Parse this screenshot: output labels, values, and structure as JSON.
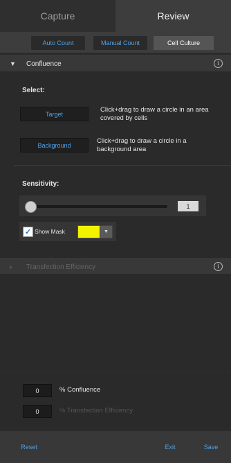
{
  "top_tabs": [
    {
      "label": "Capture"
    },
    {
      "label": "Review"
    }
  ],
  "sub_tabs": [
    {
      "label": "Auto Count"
    },
    {
      "label": "Manual Count"
    },
    {
      "label": "Cell Culture"
    }
  ],
  "confluence": {
    "title": "Confluence",
    "select_label": "Select:",
    "target_button": "Target",
    "target_hint": "Click+drag to draw a circle in an area covered by cells",
    "background_button": "Background",
    "background_hint": "Click+drag to draw a circle in a background area",
    "sensitivity_label": "Sensitivity:",
    "sensitivity_value": "1",
    "show_mask_label": "Show Mask",
    "show_mask_checked": true,
    "mask_color": "#f3f300"
  },
  "transfection": {
    "title": "Transfection Efficiency"
  },
  "results": [
    {
      "value": "0",
      "label": "% Confluence"
    },
    {
      "value": "0",
      "label": "% Transfection Efficiency"
    }
  ],
  "footer": {
    "reset": "Reset",
    "exit": "Exit",
    "save": "Save"
  }
}
